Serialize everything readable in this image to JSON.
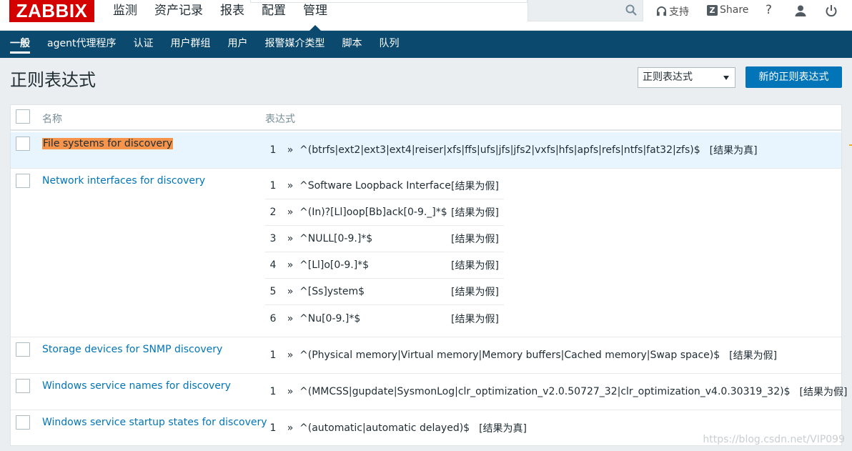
{
  "brand": {
    "logo": "ZABBIX",
    "logo_color": "#d40000"
  },
  "main_menu": [
    {
      "label": "监测"
    },
    {
      "label": "资产记录"
    },
    {
      "label": "报表"
    },
    {
      "label": "配置"
    },
    {
      "label": "管理",
      "active": true
    }
  ],
  "topbar": {
    "support_label": "支持",
    "share_label": "Share",
    "help_symbol": "?",
    "icons": [
      "search-icon",
      "headset-icon",
      "share-icon",
      "help-icon",
      "user-icon",
      "power-icon"
    ]
  },
  "sub_menu": [
    {
      "label": "一般",
      "active": true
    },
    {
      "label": "agent代理程序"
    },
    {
      "label": "认证"
    },
    {
      "label": "用户群组"
    },
    {
      "label": "用户"
    },
    {
      "label": "报警媒介类型"
    },
    {
      "label": "脚本"
    },
    {
      "label": "队列"
    }
  ],
  "page": {
    "title": "正则表达式",
    "select_value": "正则表达式",
    "new_button": "新的正则表达式"
  },
  "table": {
    "headers": {
      "name": "名称",
      "expressions": "表达式"
    },
    "rows": [
      {
        "name": "File systems for discovery",
        "expressions": [
          {
            "n": "1",
            "arrow": "»",
            "pattern": "^(btrfs|ext2|ext3|ext4|reiser|xfs|ffs|ufs|jfs|jfs2|vxfs|hfs|apfs|refs|ntfs|fat32|zfs)$",
            "result": "[结果为真]"
          }
        ]
      },
      {
        "name": "Network interfaces for discovery",
        "expressions": [
          {
            "n": "1",
            "arrow": "»",
            "pattern": "^Software Loopback Interface",
            "result": "[结果为假]"
          },
          {
            "n": "2",
            "arrow": "»",
            "pattern": "^(In)?[Ll]oop[Bb]ack[0-9._]*$",
            "result": "[结果为假]"
          },
          {
            "n": "3",
            "arrow": "»",
            "pattern": "^NULL[0-9.]*$",
            "result": "[结果为假]"
          },
          {
            "n": "4",
            "arrow": "»",
            "pattern": "^[Ll]o[0-9.]*$",
            "result": "[结果为假]"
          },
          {
            "n": "5",
            "arrow": "»",
            "pattern": "^[Ss]ystem$",
            "result": "[结果为假]"
          },
          {
            "n": "6",
            "arrow": "»",
            "pattern": "^Nu[0-9.]*$",
            "result": "[结果为假]"
          }
        ]
      },
      {
        "name": "Storage devices for SNMP discovery",
        "expressions": [
          {
            "n": "1",
            "arrow": "»",
            "pattern": "^(Physical memory|Virtual memory|Memory buffers|Cached memory|Swap space)$",
            "result": "[结果为假]"
          }
        ]
      },
      {
        "name": "Windows service names for discovery",
        "expressions": [
          {
            "n": "1",
            "arrow": "»",
            "pattern": "^(MMCSS|gupdate|SysmonLog|clr_optimization_v2.0.50727_32|clr_optimization_v4.0.30319_32)$",
            "result": "[结果为假]"
          }
        ]
      },
      {
        "name": "Windows service startup states for discovery",
        "expressions": [
          {
            "n": "1",
            "arrow": "»",
            "pattern": "^(automatic|automatic delayed)$",
            "result": "[结果为真]"
          }
        ]
      }
    ]
  },
  "watermark": "https://blog.csdn.net/VIP099",
  "colors": {
    "nav_bg": "#0b4a6e",
    "link": "#0275b8",
    "button": "#0275b8",
    "highlight_row": "#e8f5ff",
    "search_mark": "#f5944a"
  }
}
